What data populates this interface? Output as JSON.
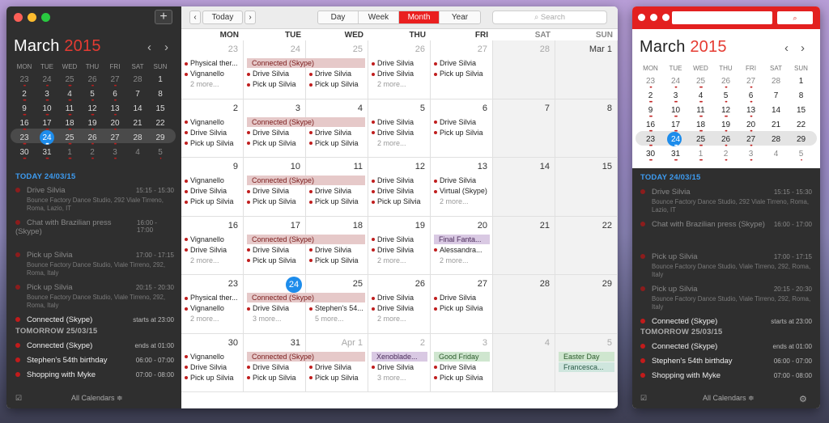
{
  "main": {
    "sidebar": {
      "month": "March",
      "year": "2015",
      "prev_icon": "‹",
      "next_icon": "›",
      "add_icon": "+",
      "dow": [
        "MON",
        "TUE",
        "WED",
        "THU",
        "FRI",
        "SAT",
        "SUN"
      ],
      "weeks": [
        [
          [
            "23",
            "o",
            2
          ],
          [
            "24",
            "o",
            2
          ],
          [
            "25",
            "o",
            3
          ],
          [
            "26",
            "o",
            2
          ],
          [
            "27",
            "o",
            2
          ],
          [
            "28",
            "o",
            0
          ],
          [
            "1",
            "",
            0
          ]
        ],
        [
          [
            "2",
            "",
            3
          ],
          [
            "3",
            "",
            3
          ],
          [
            "4",
            "",
            3
          ],
          [
            "5",
            "",
            2
          ],
          [
            "6",
            "",
            2
          ],
          [
            "7",
            "",
            0
          ],
          [
            "8",
            "",
            0
          ]
        ],
        [
          [
            "9",
            "",
            3
          ],
          [
            "10",
            "",
            3
          ],
          [
            "11",
            "",
            3
          ],
          [
            "12",
            "",
            3
          ],
          [
            "13",
            "",
            2
          ],
          [
            "14",
            "",
            0
          ],
          [
            "15",
            "",
            0
          ]
        ],
        [
          [
            "16",
            "",
            3
          ],
          [
            "17",
            "",
            3
          ],
          [
            "18",
            "",
            3
          ],
          [
            "19",
            "",
            2
          ],
          [
            "20",
            "",
            2
          ],
          [
            "21",
            "",
            0
          ],
          [
            "22",
            "",
            0
          ]
        ],
        [
          [
            "23",
            "",
            3
          ],
          [
            "24",
            "t",
            3
          ],
          [
            "25",
            "",
            3
          ],
          [
            "26",
            "",
            2
          ],
          [
            "27",
            "",
            2
          ],
          [
            "28",
            "",
            0
          ],
          [
            "29",
            "",
            0
          ]
        ],
        [
          [
            "30",
            "",
            3
          ],
          [
            "31",
            "",
            3
          ],
          [
            "1",
            "o",
            3
          ],
          [
            "2",
            "o",
            2
          ],
          [
            "3",
            "o",
            2
          ],
          [
            "4",
            "o",
            0
          ],
          [
            "5",
            "o",
            1
          ]
        ]
      ],
      "today_header": "TODAY 24/03/15",
      "today_events": [
        {
          "name": "Drive Silvia",
          "time": "15:15 - 15:30",
          "loc": "Bounce Factory Dance Studio, 292 Viale Tirreno, Roma, Lazio, IT",
          "state": "past"
        },
        {
          "name": "Chat with Brazilian press (Skype)",
          "time": "16:00 - 17:00",
          "loc": "",
          "state": "past"
        },
        {
          "name": "Pick up Silvia",
          "time": "17:00 - 17:15",
          "loc": "Bounce Factory Dance Studio, Viale Tirreno, 292, Roma, Italy",
          "state": "past"
        },
        {
          "name": "Pick up Silvia",
          "time": "20:15 - 20:30",
          "loc": "Bounce Factory Dance Studio, Viale Tirreno, 292, Roma, Italy",
          "state": "past"
        },
        {
          "name": "Connected (Skype)",
          "time": "starts at 23:00",
          "loc": "",
          "state": "cur"
        }
      ],
      "tomorrow_header": "TOMORROW 25/03/15",
      "tomorrow_events": [
        {
          "name": "Connected (Skype)",
          "time": "ends at 01:00",
          "state": "cur"
        },
        {
          "name": "Stephen's 54th birthday",
          "time": "06:00 - 07:00",
          "state": "cur"
        },
        {
          "name": "Shopping with Myke",
          "time": "07:00 - 08:00",
          "state": "cur"
        }
      ],
      "footer": "All Calendars ≑",
      "check_icon": "☑"
    },
    "toolbar": {
      "prev": "‹",
      "next": "›",
      "today": "Today",
      "views": [
        "Day",
        "Week",
        "Month",
        "Year"
      ],
      "active_view": "Month",
      "search_placeholder": "Search"
    },
    "calendar": {
      "dow": [
        "MON",
        "TUE",
        "WED",
        "THU",
        "FRI",
        "SAT",
        "SUN"
      ],
      "weeks": [
        {
          "days": [
            {
              "n": "23",
              "o": true,
              "ev": [
                "Physical ther...",
                "Vignanello"
              ],
              "more": "2 more..."
            },
            {
              "n": "24",
              "o": true,
              "ev": [
                "",
                "Drive Silvia",
                "Pick up Silvia"
              ]
            },
            {
              "n": "25",
              "o": true,
              "ev": [
                "",
                "Drive Silvia",
                "Pick up Silvia"
              ]
            },
            {
              "n": "26",
              "o": true,
              "ev": [
                "Drive Silvia",
                "Drive Silvia"
              ],
              "more": "2 more..."
            },
            {
              "n": "27",
              "o": true,
              "ev": [
                "Drive Silvia",
                "Pick up Silvia"
              ]
            },
            {
              "n": "28",
              "o": true,
              "ev": []
            },
            {
              "n": "Mar 1",
              "o": false,
              "ev": []
            }
          ],
          "bars": [
            {
              "label": "Connected (Skype)",
              "from": 1,
              "to": 2,
              "row": 0,
              "color": "pink"
            }
          ]
        },
        {
          "days": [
            {
              "n": "2",
              "ev": [
                "Vignanello",
                "Drive Silvia",
                "Pick up Silvia"
              ]
            },
            {
              "n": "3",
              "ev": [
                "",
                "Drive Silvia",
                "Pick up Silvia"
              ]
            },
            {
              "n": "4",
              "ev": [
                "",
                "Drive Silvia",
                "Pick up Silvia"
              ]
            },
            {
              "n": "5",
              "ev": [
                "Drive Silvia",
                "Drive Silvia"
              ],
              "more": "2 more..."
            },
            {
              "n": "6",
              "ev": [
                "Drive Silvia",
                "Pick up Silvia"
              ]
            },
            {
              "n": "7",
              "ev": []
            },
            {
              "n": "8",
              "ev": []
            }
          ],
          "bars": [
            {
              "label": "Connected (Skype)",
              "from": 1,
              "to": 2,
              "row": 0,
              "color": "pink"
            }
          ]
        },
        {
          "days": [
            {
              "n": "9",
              "ev": [
                "Vignanello",
                "Drive Silvia",
                "Pick up Silvia"
              ]
            },
            {
              "n": "10",
              "ev": [
                "",
                "Drive Silvia",
                "Pick up Silvia"
              ]
            },
            {
              "n": "11",
              "ev": [
                "",
                "Drive Silvia",
                "Pick up Silvia"
              ]
            },
            {
              "n": "12",
              "ev": [
                "Drive Silvia",
                "Drive Silvia",
                "Pick up Silvia"
              ]
            },
            {
              "n": "13",
              "ev": [
                "Drive Silvia",
                "Virtual (Skype)"
              ],
              "more": "2 more..."
            },
            {
              "n": "14",
              "ev": []
            },
            {
              "n": "15",
              "ev": []
            }
          ],
          "bars": [
            {
              "label": "Connected (Skype)",
              "from": 1,
              "to": 2,
              "row": 0,
              "color": "pink"
            }
          ]
        },
        {
          "days": [
            {
              "n": "16",
              "ev": [
                "Vignanello",
                "Drive Silvia"
              ],
              "more": "2 more..."
            },
            {
              "n": "17",
              "ev": [
                "",
                "Drive Silvia",
                "Pick up Silvia"
              ]
            },
            {
              "n": "18",
              "ev": [
                "",
                "Drive Silvia",
                "Pick up Silvia"
              ]
            },
            {
              "n": "19",
              "ev": [
                "Drive Silvia",
                "Drive Silvia"
              ],
              "more": "2 more..."
            },
            {
              "n": "20",
              "ev": [
                "",
                "Alessandra..."
              ],
              "more": "2 more..."
            },
            {
              "n": "21",
              "ev": []
            },
            {
              "n": "22",
              "ev": []
            }
          ],
          "bars": [
            {
              "label": "Connected (Skype)",
              "from": 1,
              "to": 2,
              "row": 0,
              "color": "pink"
            },
            {
              "label": "Final Fanta...",
              "from": 4,
              "to": 4,
              "row": 0,
              "color": "purple"
            }
          ]
        },
        {
          "days": [
            {
              "n": "23",
              "ev": [
                "Physical ther...",
                "Vignanello"
              ],
              "more": "2 more..."
            },
            {
              "n": "24",
              "t": true,
              "ev": [
                "",
                "Drive Silvia"
              ],
              "more": "3 more..."
            },
            {
              "n": "25",
              "ev": [
                "",
                "Stephen's 54..."
              ],
              "more": "5 more..."
            },
            {
              "n": "26",
              "ev": [
                "Drive Silvia",
                "Drive Silvia"
              ],
              "more": "2 more..."
            },
            {
              "n": "27",
              "ev": [
                "Drive Silvia",
                "Pick up Silvia"
              ]
            },
            {
              "n": "28",
              "ev": []
            },
            {
              "n": "29",
              "ev": []
            }
          ],
          "bars": [
            {
              "label": "Connected (Skype)",
              "from": 1,
              "to": 2,
              "row": 0,
              "color": "pink"
            }
          ]
        },
        {
          "days": [
            {
              "n": "30",
              "ev": [
                "Vignanello",
                "Drive Silvia",
                "Pick up Silvia"
              ]
            },
            {
              "n": "31",
              "ev": [
                "",
                "Drive Silvia",
                "Pick up Silvia"
              ]
            },
            {
              "n": "Apr 1",
              "o": true,
              "ev": [
                "",
                "Drive Silvia",
                "Pick up Silvia"
              ]
            },
            {
              "n": "2",
              "o": true,
              "ev": [
                "",
                "Drive Silvia"
              ],
              "more": "3 more..."
            },
            {
              "n": "3",
              "o": true,
              "ev": [
                "",
                "Drive Silvia",
                "Pick up Silvia"
              ]
            },
            {
              "n": "4",
              "o": true,
              "ev": []
            },
            {
              "n": "5",
              "o": true,
              "ev": []
            }
          ],
          "bars": [
            {
              "label": "Connected (Skype)",
              "from": 1,
              "to": 2,
              "row": 0,
              "color": "pink"
            },
            {
              "label": "Xenoblade...",
              "from": 3,
              "to": 3,
              "row": 0,
              "color": "purple"
            },
            {
              "label": "Good Friday",
              "from": 4,
              "to": 4,
              "row": 0,
              "color": "green"
            },
            {
              "label": "Easter Day",
              "from": 6,
              "to": 6,
              "row": 0,
              "color": "green"
            },
            {
              "label": "Francesca...",
              "from": 6,
              "to": 6,
              "row": 1,
              "color": "teal"
            }
          ]
        }
      ]
    }
  },
  "mini": {
    "month": "March",
    "year": "2015",
    "search_icon": "⌕",
    "dow": [
      "MON",
      "TUE",
      "WED",
      "THU",
      "FRI",
      "SAT",
      "SUN"
    ],
    "today_header": "TODAY 24/03/15",
    "tomorrow_header": "TOMORROW 25/03/15",
    "footer": "All Calendars ≑",
    "gear_icon": "⚙",
    "check_icon": "☑"
  },
  "colors": {
    "accent": "#ea1f1f",
    "today": "#1d8ceb",
    "sidebar": "#2f2f2f"
  }
}
